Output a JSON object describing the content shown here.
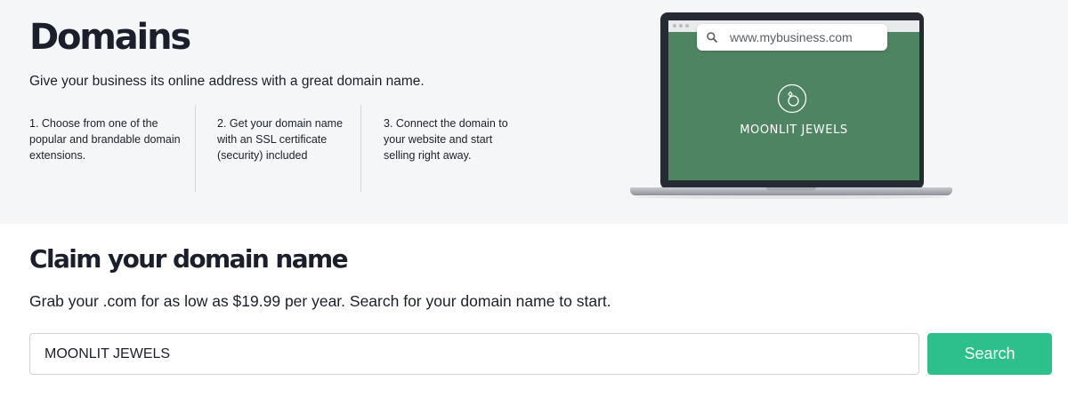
{
  "hero": {
    "title": "Domains",
    "subtitle": "Give your business its online address with a great domain name.",
    "steps": [
      {
        "text": "1. Choose from one of the popular and brandable domain extensions."
      },
      {
        "text": "2. Get your domain name with an SSL certificate (security) included"
      },
      {
        "text": "3. Connect the domain to your website and start selling right away."
      }
    ],
    "illustration": {
      "url": "www.mybusiness.com",
      "brand_name": "MOONLIT JEWELS",
      "screen_color": "#4f8462"
    }
  },
  "claim": {
    "title": "Claim your domain name",
    "description": "Grab your .com for as low as $19.99 per year. Search for your domain name to start.",
    "search_value": "MOONLIT JEWELS",
    "search_button": "Search",
    "button_color": "#2dc08d"
  }
}
